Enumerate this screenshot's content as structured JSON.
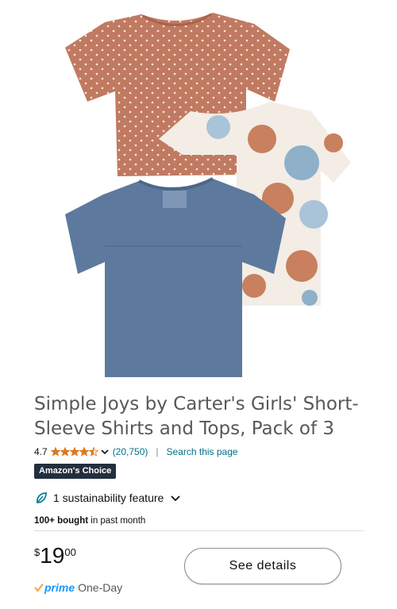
{
  "product": {
    "title": "Simple Joys by Carter's Girls' Short-Sleeve Shirts and Tops, Pack of 3",
    "rating": "4.7",
    "stars": 4.5,
    "review_count": "(20,750)",
    "search_link": "Search this page",
    "badge": "Amazon's Choice",
    "sustainability": "1 sustainability feature",
    "bought_bold": "100+ bought",
    "bought_rest": " in past month",
    "price": {
      "currency": "$",
      "whole": "19",
      "fraction": "00"
    },
    "delivery": {
      "prime": "prime",
      "speed": "One-Day"
    },
    "cta": "See details"
  },
  "colors": {
    "star": "#de7921",
    "link": "#007185",
    "badge_bg": "#232f3e",
    "prime": "#1a98ff",
    "check": "#f3a847",
    "leaf": "#008296"
  },
  "icons": [
    "star-icon",
    "chevron-down-icon",
    "leaf-icon",
    "prime-check-icon"
  ]
}
